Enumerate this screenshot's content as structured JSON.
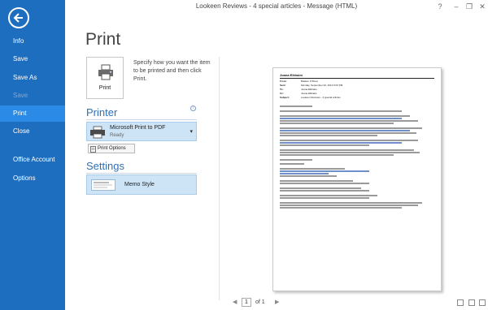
{
  "window": {
    "title": "Lookeen Reviews - 4 special articles - Message (HTML)",
    "help_label": "?",
    "minimize_label": "–",
    "restore_label": "❐",
    "close_label": "✕"
  },
  "sidebar": {
    "items": [
      {
        "label": "Info"
      },
      {
        "label": "Save"
      },
      {
        "label": "Save As"
      },
      {
        "label": "Save Attachments",
        "disabled": true
      },
      {
        "label": "Print",
        "active": true
      },
      {
        "label": "Close"
      },
      {
        "label": "Office Account"
      },
      {
        "label": "Options"
      }
    ]
  },
  "print": {
    "title": "Print",
    "button_label": "Print",
    "description": "Specify how you want the item to be printed and then click Print."
  },
  "printer": {
    "heading": "Printer",
    "name": "Microsoft Print to PDF",
    "status": "Ready",
    "options_label": "Print Options",
    "info_glyph": "i"
  },
  "settings": {
    "heading": "Settings",
    "style": "Memo Style"
  },
  "preview": {
    "sender": "Joana Elkhaire",
    "headers": [
      {
        "key": "From:",
        "value": "Bokken O'Rone"
      },
      {
        "key": "Sent:",
        "value": "Monday, September 02, 2013 5:03 PM"
      },
      {
        "key": "To:",
        "value": "Joana Elkhaire"
      },
      {
        "key": "Cc:",
        "value": "Joana Elkhaire"
      },
      {
        "key": "Subject:",
        "value": "Lookeen Reviews - 4 special articles"
      }
    ]
  },
  "pager": {
    "prev": "◀",
    "current": "1",
    "of_text": "of 1",
    "next": "▶"
  },
  "colors": {
    "sidebar": "#1e6ec0",
    "sidebar_active": "#2a8ae6",
    "accent": "#2f6fb6",
    "selection": "#cde4f7"
  }
}
